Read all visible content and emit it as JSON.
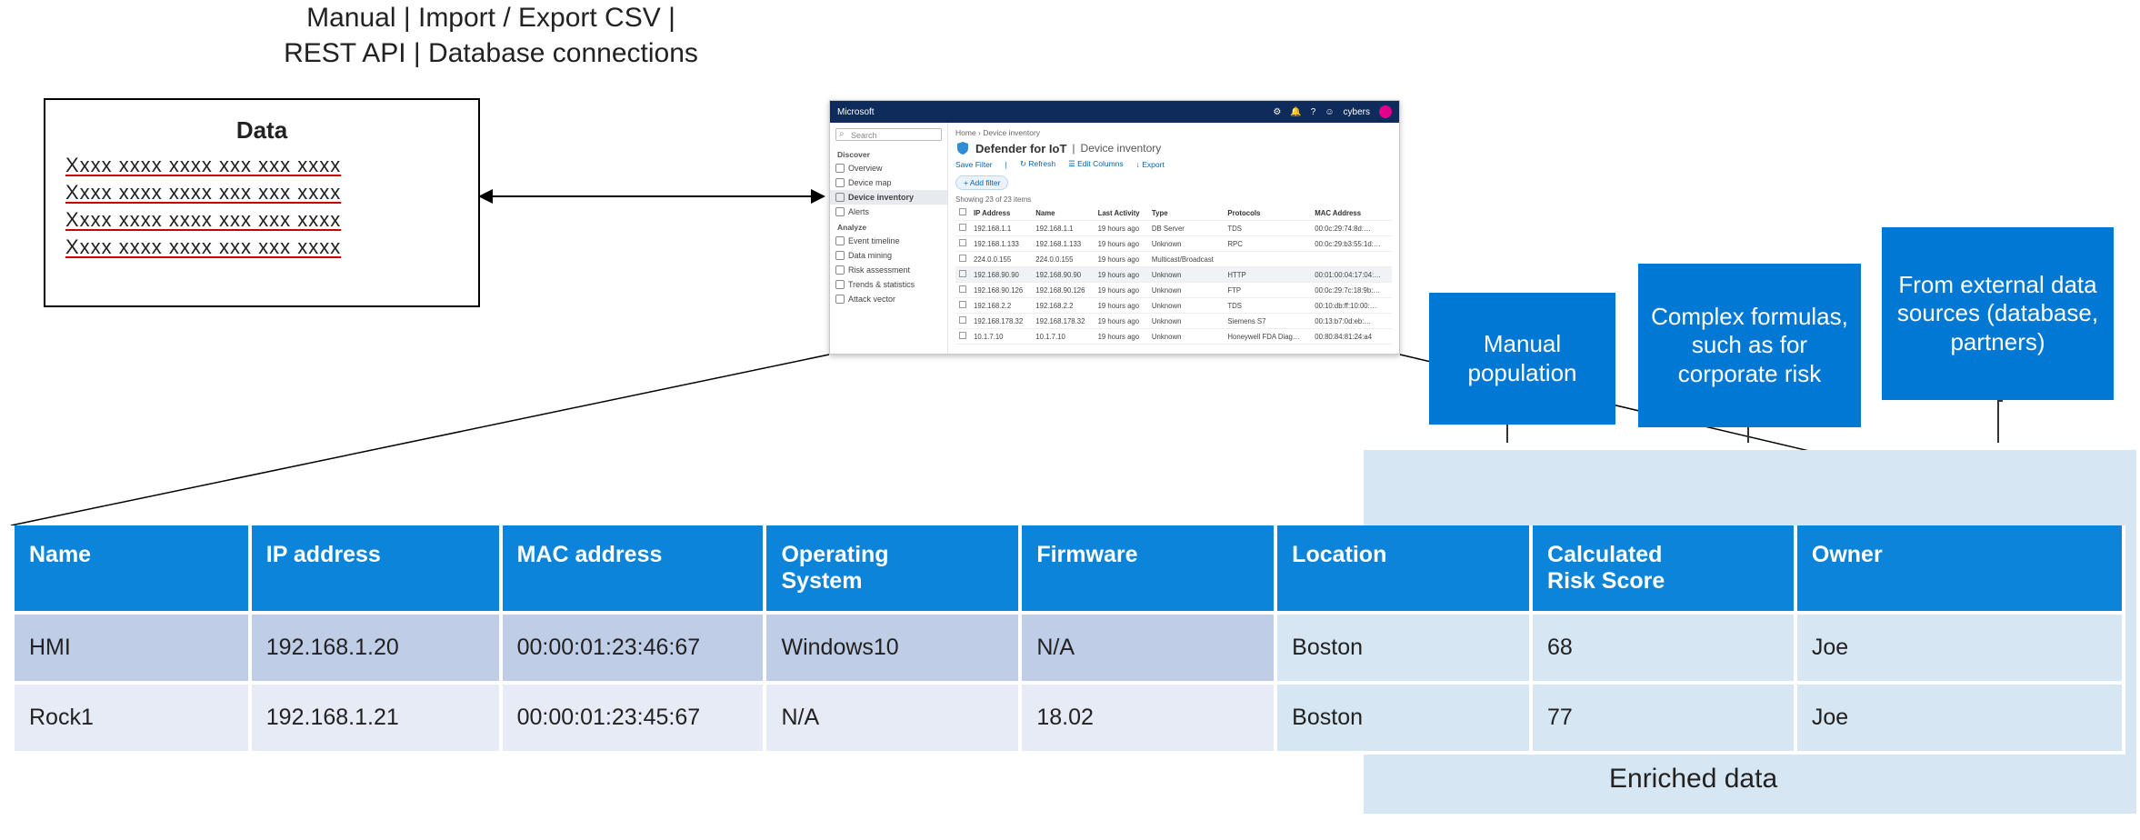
{
  "top_label_line1": "Manual | Import / Export CSV |",
  "top_label_line2": "REST API | Database connections",
  "data_box": {
    "title": "Data",
    "placeholder_row": "Xxxx xxxx xxxx xxx xxx xxxx"
  },
  "app": {
    "brand": "Microsoft",
    "user_short": "cybers",
    "crumb": "Home  ›  Device inventory",
    "product": "Defender for IoT",
    "page": "Device inventory",
    "toolbar": {
      "save_filter": "Save Filter",
      "refresh": "↻  Refresh",
      "edit_cols": "☰  Edit Columns",
      "export": "↓  Export"
    },
    "add_filter": "+ Add filter",
    "count_text": "Showing 23 of 23 items",
    "search_placeholder": "Search",
    "side": {
      "discover": "Discover",
      "items_discover": [
        "Overview",
        "Device map",
        "Device inventory",
        "Alerts"
      ],
      "analyze": "Analyze",
      "items_analyze": [
        "Event timeline",
        "Data mining",
        "Risk assessment",
        "Trends & statistics",
        "Attack vector"
      ]
    },
    "cols": [
      "",
      "IP Address",
      "Name",
      "Last Activity",
      "Type",
      "Protocols",
      "MAC Address"
    ],
    "rows": [
      [
        "",
        "192.168.1.1",
        "192.168.1.1",
        "19 hours ago",
        "DB Server",
        "TDS",
        "00:0c:29:74:8d:…"
      ],
      [
        "",
        "192.168.1.133",
        "192.168.1.133",
        "19 hours ago",
        "Unknown",
        "RPC",
        "00:0c:29:b3:55:1d:…"
      ],
      [
        "",
        "224.0.0.155",
        "224.0.0.155",
        "19 hours ago",
        "Multicast/Broadcast",
        "",
        ""
      ],
      [
        "",
        "192.168.90.90",
        "192.168.90.90",
        "19 hours ago",
        "Unknown",
        "HTTP",
        "00:01:00:04:17:04:…"
      ],
      [
        "",
        "192.168.90.126",
        "192.168.90.126",
        "19 hours ago",
        "Unknown",
        "FTP",
        "00:0c:29:7c:18:9b:…"
      ],
      [
        "",
        "192.168.2.2",
        "192.168.2.2",
        "19 hours ago",
        "Unknown",
        "TDS",
        "00:10:db:ff:10:00:…"
      ],
      [
        "",
        "192.168.178.32",
        "192.168.178.32",
        "19 hours ago",
        "Unknown",
        "Siemens S7",
        "00:13:b7:0d:eb:…"
      ],
      [
        "",
        "10.1.7.10",
        "10.1.7.10",
        "19 hours ago",
        "Unknown",
        "Honeywell FDA Diag…",
        "00:80:84:81:24:a4"
      ]
    ]
  },
  "callouts": {
    "manual": "Manual population",
    "formula": "Complex formulas, such as for corporate risk",
    "external": "From external data sources (database, partners)"
  },
  "enriched_label": "Enriched data",
  "table": {
    "headers": [
      "Name",
      "IP address",
      "MAC address",
      "Operating System",
      "Firmware",
      "Location",
      "Calculated Risk Score",
      "Owner"
    ],
    "rows": [
      [
        "HMI",
        "192.168.1.20",
        "00:00:01:23:46:67",
        "Windows10",
        "N/A",
        "Boston",
        "68",
        "Joe"
      ],
      [
        "Rock1",
        "192.168.1.21",
        "00:00:01:23:45:67",
        "N/A",
        "18.02",
        "Boston",
        "77",
        "Joe"
      ]
    ]
  }
}
